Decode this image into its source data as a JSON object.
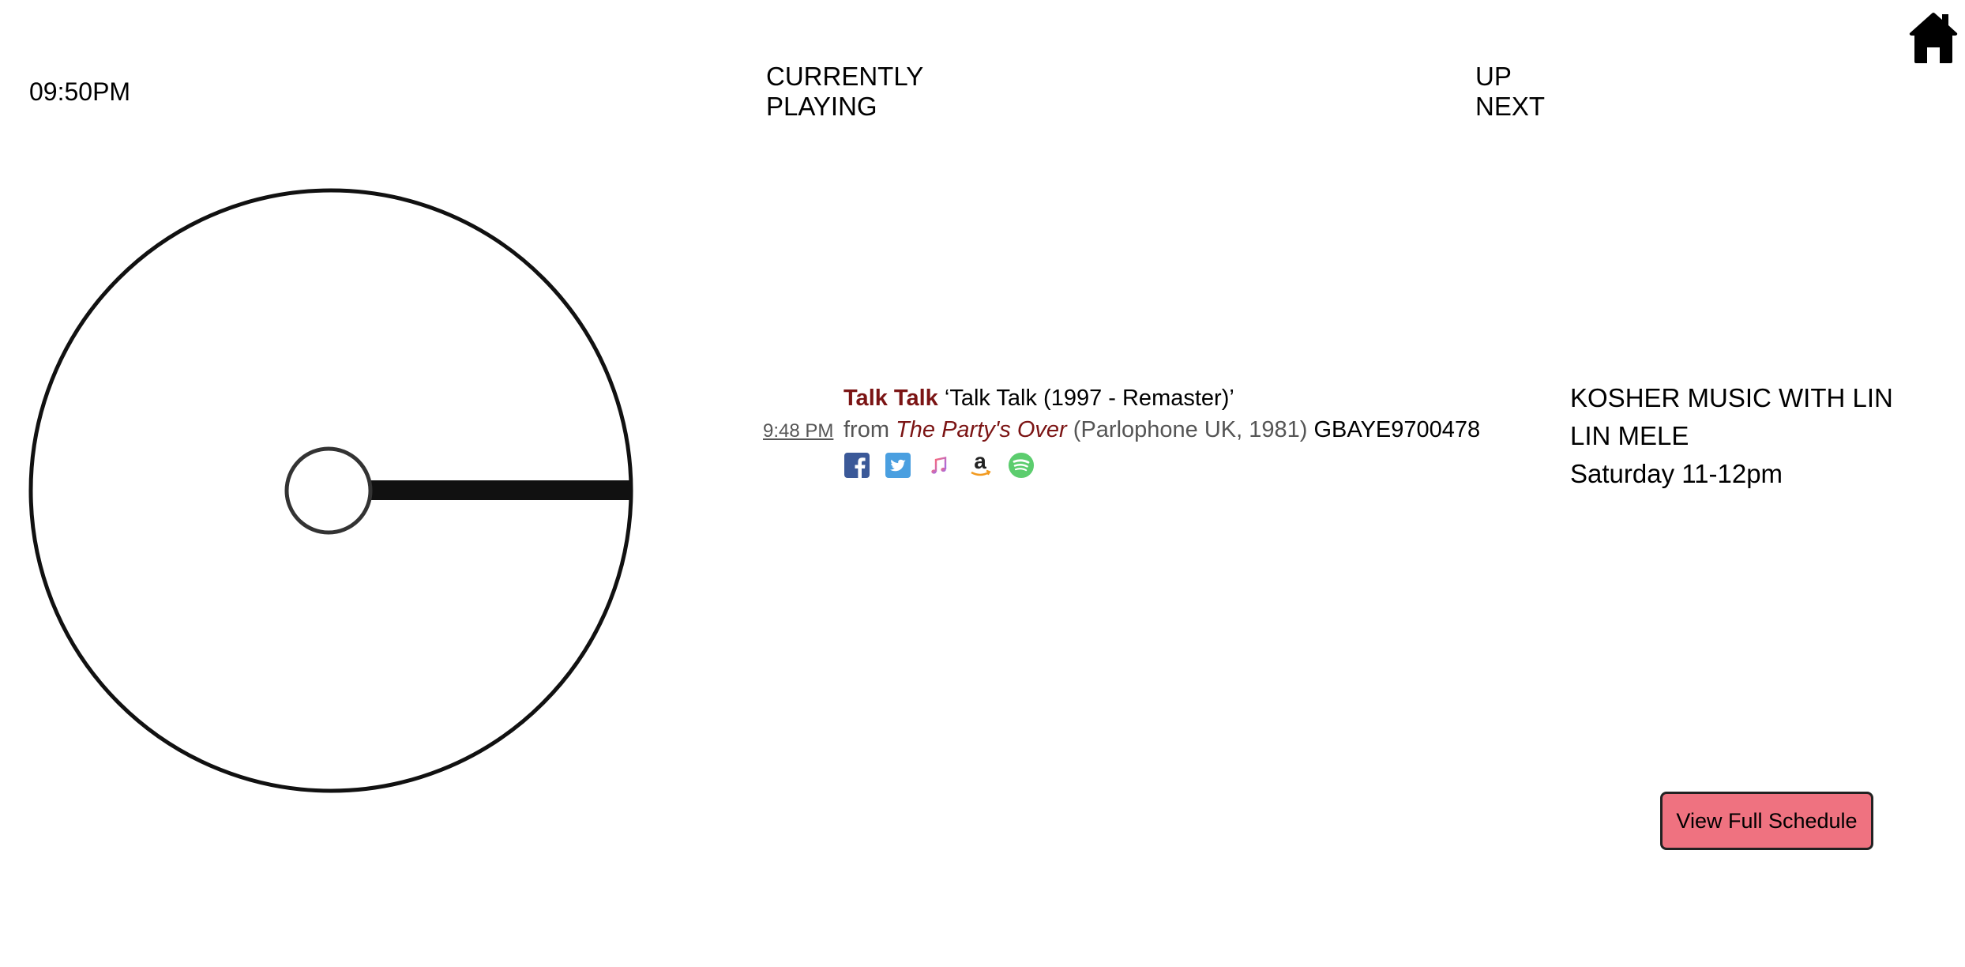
{
  "clock": {
    "time": "09:50PM"
  },
  "current": {
    "heading_line1": "CURRENTLY",
    "heading_line2": "PLAYING",
    "track": {
      "artist": "Talk Talk",
      "song": "‘Talk Talk (1997 - Remaster)’",
      "time": "9:48 PM",
      "from_label": "from",
      "album": "The Party's Over",
      "label_info": "(Parlophone UK, 1981)",
      "isrc": "GBAYE9700478"
    },
    "share_icons": [
      "facebook-icon",
      "twitter-icon",
      "apple-music-icon",
      "amazon-icon",
      "spotify-icon"
    ]
  },
  "next": {
    "heading_line1": "UP",
    "heading_line2": "NEXT",
    "show_title": "KOSHER MUSIC WITH LIN LIN MELE",
    "show_time": "Saturday 11-12pm"
  },
  "actions": {
    "schedule_button": "View Full Schedule"
  },
  "colors": {
    "accent": "#7b1414",
    "button": "#ef7280",
    "facebook": "#3b5998",
    "twitter": "#4a9fe0",
    "spotify": "#1db954"
  }
}
